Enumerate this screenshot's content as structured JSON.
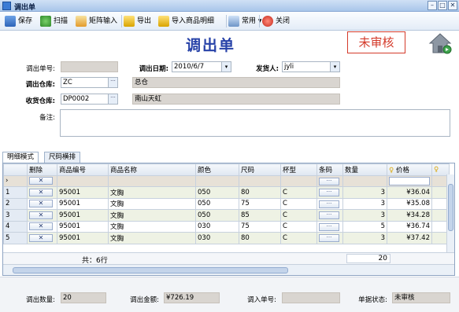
{
  "window": {
    "title": "调出单"
  },
  "toolbar": {
    "save": "保存",
    "scan": "扫描",
    "matrix_input": "矩阵输入",
    "export": "导出",
    "import_detail": "导入商品明细",
    "common": "常用",
    "close": "关闭"
  },
  "header": {
    "doc_title": "调出单",
    "status_stamp": "未审核"
  },
  "form": {
    "doc_no_label": "调出单号:",
    "doc_no_value": "",
    "out_date_label": "调出日期:",
    "out_date_value": "2010/6/7",
    "sender_label": "发货人:",
    "sender_value": "jyli",
    "out_wh_label": "调出仓库:",
    "out_wh_code": "ZC",
    "out_wh_name": "总仓",
    "recv_wh_label": "收货仓库:",
    "recv_wh_code": "DP0002",
    "recv_wh_name": "南山天虹",
    "remark_label": "备注:",
    "remark_value": ""
  },
  "tabs": [
    {
      "label": "明细模式",
      "active": true
    },
    {
      "label": "尺码横排",
      "active": false
    }
  ],
  "grid": {
    "columns": [
      "删除",
      "商品编号",
      "商品名称",
      "颜色",
      "尺码",
      "杯型",
      "条码",
      "数量",
      "价格"
    ],
    "delete_label": "✕",
    "barcode_label": "···",
    "rows": [
      {
        "idx": "1",
        "code": "95001",
        "name": "文胸",
        "color": "050",
        "size": "80",
        "cup": "C",
        "qty": "3",
        "price": "¥36.04"
      },
      {
        "idx": "2",
        "code": "95001",
        "name": "文胸",
        "color": "050",
        "size": "75",
        "cup": "C",
        "qty": "3",
        "price": "¥35.08"
      },
      {
        "idx": "3",
        "code": "95001",
        "name": "文胸",
        "color": "050",
        "size": "85",
        "cup": "C",
        "qty": "3",
        "price": "¥34.28"
      },
      {
        "idx": "4",
        "code": "95001",
        "name": "文胸",
        "color": "030",
        "size": "75",
        "cup": "C",
        "qty": "5",
        "price": "¥36.74"
      },
      {
        "idx": "5",
        "code": "95001",
        "name": "文胸",
        "color": "030",
        "size": "80",
        "cup": "C",
        "qty": "3",
        "price": "¥37.42"
      }
    ],
    "footer_count": "共：6行",
    "footer_qty": "20"
  },
  "summary": {
    "out_qty_label": "调出数量:",
    "out_qty_value": "20",
    "out_amount_label": "调出金额:",
    "out_amount_value": "¥726.19",
    "in_doc_label": "调入单号:",
    "in_doc_value": "",
    "doc_status_label": "单据状态:",
    "doc_status_value": "未审核"
  },
  "colors": {
    "title_blue": "#2742a8",
    "stamp_red": "#d43a2a",
    "readonly_gray": "#d9d5d0"
  }
}
